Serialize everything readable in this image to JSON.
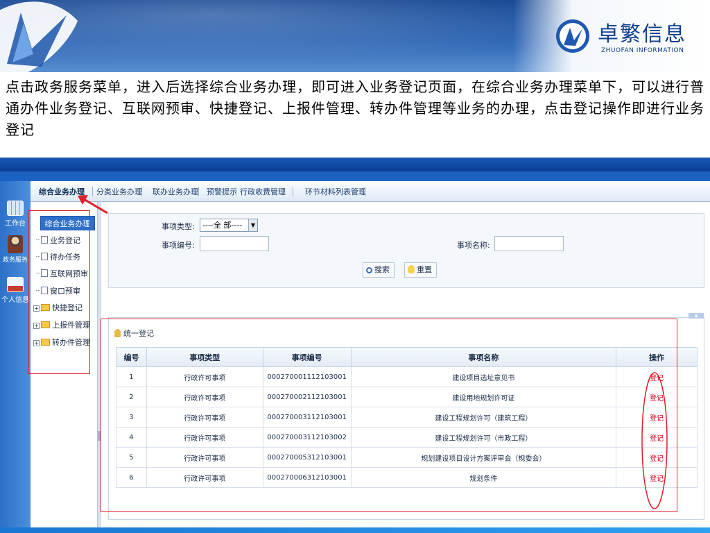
{
  "header": {
    "brand_cn": "卓繁信息",
    "brand_en": "ZHUOFAN INFORMATION",
    "primary_color": "#1f58b0"
  },
  "description": "点击政务服务菜单，进入后选择综合业务办理，即可进入业务登记页面，在综合业务办理菜单下，可以进行普通办件业务登记、互联网预审、快捷登记、上报件管理、转办件管理等业务的办理，点击登记操作即进行业务登记",
  "app": {
    "left_rail": [
      {
        "label": "工作台",
        "icon": "workbench-icon"
      },
      {
        "label": "政务服务",
        "icon": "gov-service-icon"
      },
      {
        "label": "个人信息",
        "icon": "personal-info-icon"
      }
    ],
    "tabs": [
      "综合业务办理",
      "分类业务办理",
      "联办业务办理",
      "预警提示",
      "行政收费管理",
      "环节材料列表管理"
    ],
    "tree": {
      "root": "综合业务办理",
      "items": [
        "业务登记",
        "待办任务",
        "互联网预审",
        "窗口预审"
      ],
      "folders": [
        "快捷登记",
        "上报件管理",
        "转办件管理"
      ]
    },
    "search": {
      "type_label": "事项类型:",
      "type_value": "----全 部----",
      "code_label": "事项编号:",
      "code_value": "",
      "name_label": "事项名称:",
      "name_value": "",
      "search_button": "搜索",
      "reset_button": "重置"
    },
    "grid": {
      "title": "统一登记",
      "columns": [
        "编号",
        "事项类型",
        "事项编号",
        "事项名称",
        "操作"
      ],
      "rows": [
        [
          "1",
          "行政许可事项",
          "000270001112103001",
          "建设项目选址意见书",
          "登记"
        ],
        [
          "2",
          "行政许可事项",
          "000270002112103001",
          "建设用地规划许可证",
          "登记"
        ],
        [
          "3",
          "行政许可事项",
          "000270003112103001",
          "建设工程规划许可（建筑工程）",
          "登记"
        ],
        [
          "4",
          "行政许可事项",
          "000270003112103002",
          "建设工程规划许可（市政工程）",
          "登记"
        ],
        [
          "5",
          "行政许可事项",
          "000270005312103001",
          "规划建设项目设计方案评审会（规委会）",
          "登记"
        ],
        [
          "6",
          "行政许可事项",
          "000270006312103001",
          "规划条件",
          "登记"
        ]
      ]
    }
  }
}
